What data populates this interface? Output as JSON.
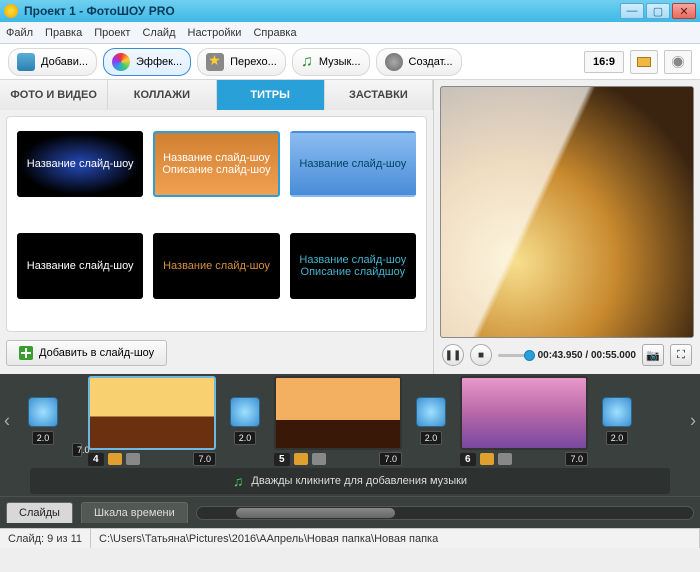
{
  "window": {
    "title": "Проект 1 - ФотоШОУ PRO"
  },
  "menu": {
    "file": "Файл",
    "edit": "Правка",
    "project": "Проект",
    "slide": "Слайд",
    "settings": "Настройки",
    "help": "Справка"
  },
  "toolbar": {
    "add": "Добави...",
    "effects": "Эффек...",
    "transitions": "Перехо...",
    "music": "Музык...",
    "create": "Создат...",
    "aspect": "16:9"
  },
  "tabs": {
    "photo": "ФОТО И ВИДЕО",
    "collage": "КОЛЛАЖИ",
    "titles": "ТИТРЫ",
    "splash": "ЗАСТАВКИ"
  },
  "titles_gallery": {
    "t1": "Название слайд-шоу",
    "t2a": "Название слайд-шоу",
    "t2b": "Описание слайд-шоу",
    "t3": "Название слайд-шоу",
    "t4": "Название слайд-шоу",
    "t5": "Название слайд-шоу",
    "t6a": "Название слайд-шоу",
    "t6b": "Описание слайдшоу"
  },
  "add_slide_btn": "Добавить в слайд-шоу",
  "player": {
    "time": "00:43.950 / 00:55.000"
  },
  "timeline": {
    "transA": "7.0",
    "transB": "2.0",
    "transC": "2.0",
    "transD": "2.0",
    "transE": "2.0",
    "slide4_num": "4",
    "slide4_dur": "7.0",
    "slide5_num": "5",
    "slide5_dur": "7.0",
    "slide6_num": "6",
    "slide6_dur": "7.0",
    "music_hint": "Дважды кликните для добавления музыки",
    "tab_slides": "Слайды",
    "tab_scale": "Шкала времени"
  },
  "status": {
    "slide": "Слайд: 9 из 11",
    "path": "C:\\Users\\Татьяна\\Pictures\\2016\\ААпрель\\Новая папка\\Новая папка"
  }
}
